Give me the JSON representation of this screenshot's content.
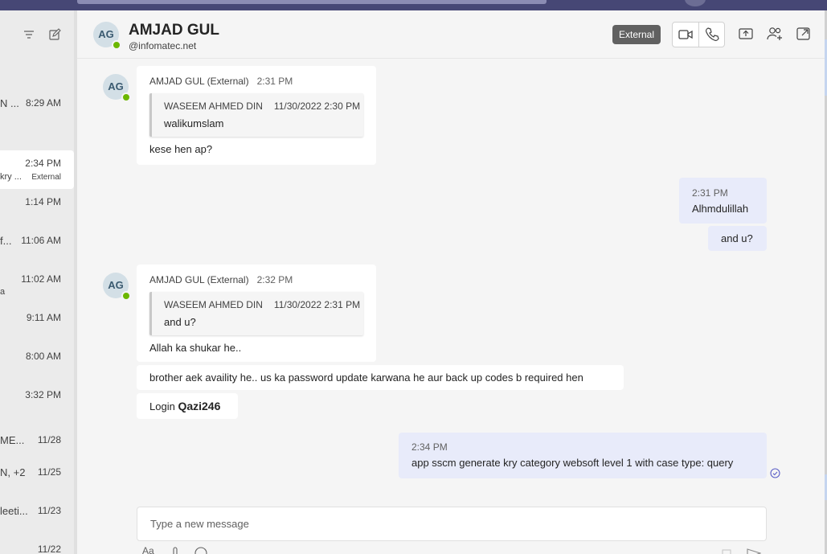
{
  "left_panel": {
    "icons": [
      "filter-icon",
      "new-chat-icon"
    ],
    "items": [
      {
        "name": "N ...",
        "time": "8:29 AM",
        "sub": "",
        "badge": ""
      },
      {
        "name": "",
        "time": "2:34 PM",
        "sub": "kry ...",
        "badge": "External"
      },
      {
        "name": "",
        "time": "1:14 PM",
        "sub": "",
        "badge": ""
      },
      {
        "name": "f...",
        "time": "11:06 AM",
        "sub": "",
        "badge": ""
      },
      {
        "name": "",
        "time": "11:02 AM",
        "sub": "a",
        "badge": ""
      },
      {
        "name": "",
        "time": "9:11 AM",
        "sub": "",
        "badge": ""
      },
      {
        "name": "",
        "time": "8:00 AM",
        "sub": "",
        "badge": ""
      },
      {
        "name": "",
        "time": "3:32 PM",
        "sub": "",
        "badge": ""
      },
      {
        "name": "ME...",
        "time": "11/28",
        "sub": "",
        "badge": ""
      },
      {
        "name": "N, +2",
        "time": "11/25",
        "sub": "",
        "badge": ""
      },
      {
        "name": "leeti...",
        "time": "11/23",
        "sub": "",
        "badge": ""
      },
      {
        "name": "",
        "time": "11/22",
        "sub": "",
        "badge": ""
      }
    ]
  },
  "header": {
    "initials": "AG",
    "name": "AMJAD GUL",
    "subtitle": "@infomatec.net",
    "external_badge": "External",
    "icons": [
      "video-call-icon",
      "audio-call-icon",
      "share-screen-icon",
      "add-people-icon",
      "pop-out-icon"
    ]
  },
  "messages": [
    {
      "from": "them",
      "initials": "AG",
      "author": "AMJAD GUL (External)",
      "time": "2:31 PM",
      "quote": {
        "author": "WASEEM AHMED DIN",
        "time": "11/30/2022 2:30 PM",
        "text": "walikumslam"
      },
      "text": "kese hen ap?"
    },
    {
      "from": "me",
      "time": "2:31 PM",
      "text": "Alhmdulillah"
    },
    {
      "from": "me",
      "time": "",
      "text": "and u?"
    },
    {
      "from": "them",
      "initials": "AG",
      "author": "AMJAD GUL (External)",
      "time": "2:32 PM",
      "quote": {
        "author": "WASEEM AHMED DIN",
        "time": "11/30/2022 2:31 PM",
        "text": "and u?"
      },
      "text": "Allah ka shukar he.."
    },
    {
      "from": "them",
      "text": "brother aek availity he.. us ka password update karwana he aur back up codes b required hen"
    },
    {
      "from": "them",
      "text_prefix": "Login",
      "text_bold": "Qazi246"
    },
    {
      "from": "me",
      "time": "2:34 PM",
      "text": "app sscm generate kry category websoft level 1 with case type: query"
    }
  ],
  "compose": {
    "placeholder": "Type a new message",
    "format_label": "Aa"
  },
  "colors": {
    "topbar": "#464775",
    "presence": "#6bb700",
    "mine_bubble": "#e8ebfa",
    "accent": "#5b5fc7"
  }
}
